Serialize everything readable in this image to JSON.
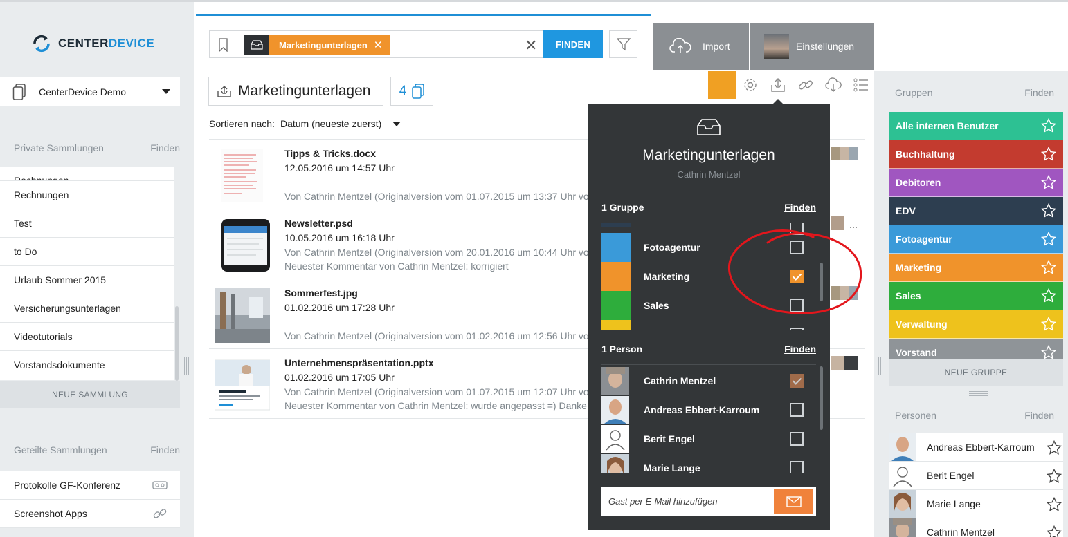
{
  "brand": {
    "name_main": "CENTER",
    "name_accent": "DEVICE"
  },
  "workspace": {
    "label": "CenterDevice Demo"
  },
  "private_collections": {
    "title": "Private Sammlungen",
    "find": "Finden",
    "items": [
      "Rechnungen",
      "Rechnungen",
      "Test",
      "to Do",
      "Urlaub Sommer 2015",
      "Versicherungsunterlagen",
      "Videotutorials",
      "Vorstandsdokumente"
    ],
    "new_label": "NEUE SAMMLUNG"
  },
  "shared_collections": {
    "title": "Geteilte Sammlungen",
    "find": "Finden",
    "items": [
      "Protokolle GF-Konferenz",
      "Screenshot Apps"
    ]
  },
  "search": {
    "chip_label": "Marketingunterlagen",
    "find_button": "FINDEN"
  },
  "toolbar": {
    "import_label": "Import",
    "settings_label": "Einstellungen"
  },
  "collection": {
    "title": "Marketingunterlagen",
    "doc_count": "4",
    "sort_label": "Sortieren nach:",
    "sort_value": "Datum (neueste zuerst)"
  },
  "documents": [
    {
      "name": "Tipps & Tricks.docx",
      "date": "12.05.2016 um 14:57 Uhr",
      "line1": "Von Cathrin Mentzel (Originalversion vom 01.07.2015 um 13:37 Uhr vo",
      "line2": ""
    },
    {
      "name": "Newsletter.psd",
      "date": "10.05.2016 um 16:18 Uhr",
      "line1": "Von Cathrin Mentzel (Originalversion vom 20.01.2016 um 10:44 Uhr vo",
      "line2": "Neuester Kommentar von Cathrin Mentzel: korrigiert"
    },
    {
      "name": "Sommerfest.jpg",
      "date": "01.02.2016 um 17:28 Uhr",
      "line1": "Von Cathrin Mentzel (Originalversion vom 01.02.2016 um 12:56 Uhr vo",
      "line2": ""
    },
    {
      "name": "Unternehmenspräsentation.pptx",
      "date": "01.02.2016 um 17:05 Uhr",
      "line1": "Von Cathrin Mentzel (Originalversion vom 01.07.2015 um 12:07 Uhr vo",
      "line2": "Neuester Kommentar von Cathrin Mentzel: wurde angepasst =) Danke"
    }
  ],
  "popup": {
    "title": "Marketingunterlagen",
    "owner": "Cathrin Mentzel",
    "groups_heading": "1 Gruppe",
    "groups_find": "Finden",
    "groups": [
      {
        "label": "Fotoagentur",
        "color": "#3a9ad9",
        "checked": false
      },
      {
        "label": "Marketing",
        "color": "#f0932b",
        "checked": true
      },
      {
        "label": "Sales",
        "color": "#2ead3c",
        "checked": false
      }
    ],
    "persons_heading": "1 Person",
    "persons_find": "Finden",
    "persons": [
      "Cathrin Mentzel",
      "Andreas Ebbert-Karroum",
      "Berit Engel",
      "Marie Lange"
    ],
    "guest_placeholder": "Gast per E-Mail hinzufügen"
  },
  "groups_panel": {
    "title": "Gruppen",
    "find": "Finden",
    "items": [
      {
        "label": "Alle internen Benutzer",
        "color": "#2dc193"
      },
      {
        "label": "Buchhaltung",
        "color": "#c33b2f"
      },
      {
        "label": "Debitoren",
        "color": "#a056c0"
      },
      {
        "label": "EDV",
        "color": "#2d3e50"
      },
      {
        "label": "Fotoagentur",
        "color": "#3a9ad9"
      },
      {
        "label": "Marketing",
        "color": "#f0932b"
      },
      {
        "label": "Sales",
        "color": "#2ead3c"
      },
      {
        "label": "Verwaltung",
        "color": "#eec21c"
      },
      {
        "label": "Vorstand",
        "color": "#8f9498"
      }
    ],
    "new_label": "NEUE GRUPPE"
  },
  "persons_panel": {
    "title": "Personen",
    "find": "Finden",
    "items": [
      "Andreas Ebbert-Karroum",
      "Berit Engel",
      "Marie Lange",
      "Cathrin Mentzel"
    ]
  }
}
